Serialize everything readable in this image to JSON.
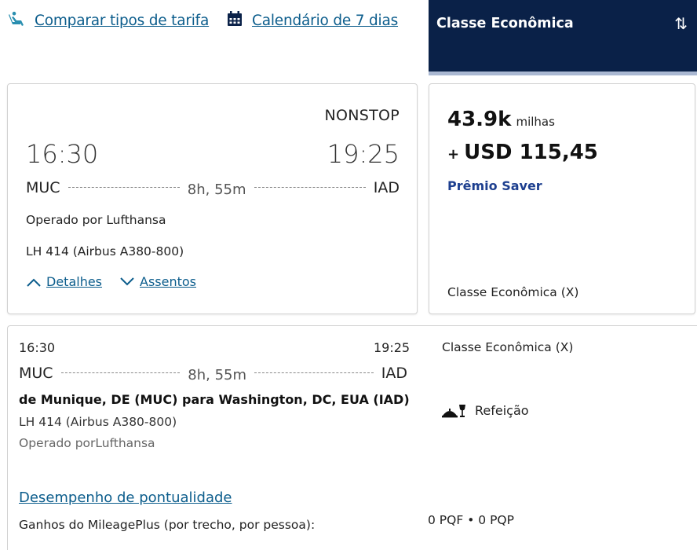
{
  "topbar": {
    "compare_label": "Comparar tipos de tarifa",
    "calendar_label": "Calendário de 7 dias"
  },
  "fare_header": {
    "title": "Classe Econômica",
    "sort_glyph": "⇅"
  },
  "flight": {
    "nonstop": "NONSTOP",
    "departure_time": "16:30",
    "arrival_time": "19:25",
    "origin": "MUC",
    "destination": "IAD",
    "duration": "8h, 55m",
    "operated_by": "Operado por Lufthansa",
    "flight_number": "LH 414 (Airbus A380-800)",
    "details_label": "Detalhes",
    "seats_label": "Assentos"
  },
  "fare": {
    "miles_value": "43.9k",
    "miles_unit": "milhas",
    "cash_prefix": "+",
    "cash_amount": "USD 115,45",
    "fare_type": "Prêmio Saver",
    "cabin_class": "Classe Econômica (X)"
  },
  "details": {
    "departure_time": "16:30",
    "arrival_time": "19:25",
    "origin": "MUC",
    "destination": "IAD",
    "duration": "8h, 55m",
    "from_to": "de Munique, DE (MUC) para Washington, DC, EUA (IAD)",
    "flight_number": "LH 414 (Airbus A380-800)",
    "operated_by": "Operado porLufthansa",
    "cabin_class": "Classe Econômica (X)",
    "meal": "Refeição",
    "ontime_link": "Desempenho de pontualidade",
    "earnings_label": "Ganhos do MileagePlus (por trecho, por pessoa):",
    "pqf": "0 PQF",
    "separator": "•",
    "pqp": "0 PQP"
  },
  "colors": {
    "link": "#0c5d8c",
    "header_bg": "#0a2148",
    "saver": "#1d3f8f"
  },
  "icons": {
    "compare": "seat-icon",
    "calendar": "calendar-icon",
    "sort": "sort-icon",
    "details_toggle": "chevron-up-icon",
    "seats_toggle": "chevron-down-icon",
    "meal": "meal-icon"
  }
}
